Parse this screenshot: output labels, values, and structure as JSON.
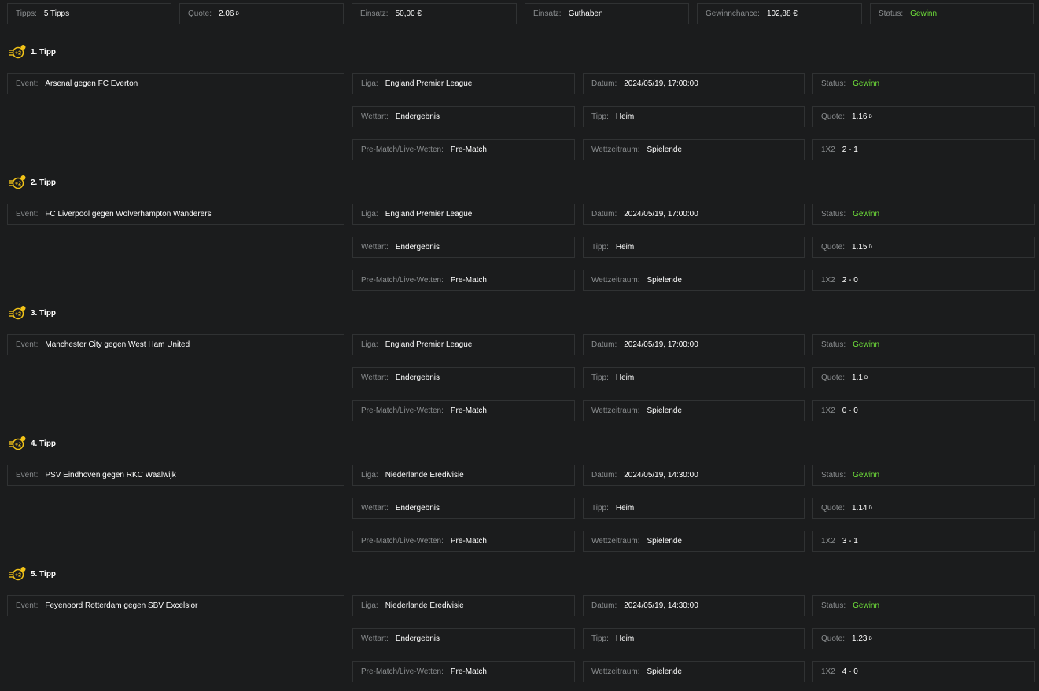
{
  "summary": [
    {
      "label": "Tipps:",
      "value": "5 Tipps",
      "sup": ""
    },
    {
      "label": "Quote:",
      "value": "2.06",
      "sup": "D"
    },
    {
      "label": "Einsatz:",
      "value": "50,00 €",
      "sup": ""
    },
    {
      "label": "Einsatz:",
      "value": "Guthaben",
      "sup": ""
    },
    {
      "label": "Gewinnchance:",
      "value": "102,88 €",
      "sup": ""
    },
    {
      "label": "Status:",
      "value": "Gewinn",
      "sup": "",
      "status": true
    }
  ],
  "labels": {
    "event": "Event:",
    "liga": "Liga:",
    "datum": "Datum:",
    "status": "Status:",
    "wettart": "Wettart:",
    "tipp": "Tipp:",
    "quote": "Quote:",
    "prematch": "Pre-Match/Live-Wetten:",
    "wettzeitraum": "Wettzeitraum:",
    "onex2": "1X2",
    "badge": "+2"
  },
  "tipps": [
    {
      "title": "1. Tipp",
      "event": "Arsenal gegen FC Everton",
      "liga": "England Premier League",
      "datum": "2024/05/19, 17:00:00",
      "status": "Gewinn",
      "wettart": "Endergebnis",
      "tipp": "Heim",
      "quote": "1.16",
      "quote_sup": "D",
      "prematch": "Pre-Match",
      "wettzeitraum": "Spielende",
      "result": "2 - 1"
    },
    {
      "title": "2. Tipp",
      "event": "FC Liverpool gegen Wolverhampton Wanderers",
      "liga": "England Premier League",
      "datum": "2024/05/19, 17:00:00",
      "status": "Gewinn",
      "wettart": "Endergebnis",
      "tipp": "Heim",
      "quote": "1.15",
      "quote_sup": "D",
      "prematch": "Pre-Match",
      "wettzeitraum": "Spielende",
      "result": "2 - 0"
    },
    {
      "title": "3. Tipp",
      "event": "Manchester City gegen West Ham United",
      "liga": "England Premier League",
      "datum": "2024/05/19, 17:00:00",
      "status": "Gewinn",
      "wettart": "Endergebnis",
      "tipp": "Heim",
      "quote": "1.1",
      "quote_sup": "D",
      "prematch": "Pre-Match",
      "wettzeitraum": "Spielende",
      "result": "0 - 0"
    },
    {
      "title": "4. Tipp",
      "event": "PSV Eindhoven gegen RKC Waalwijk",
      "liga": "Niederlande Eredivisie",
      "datum": "2024/05/19, 14:30:00",
      "status": "Gewinn",
      "wettart": "Endergebnis",
      "tipp": "Heim",
      "quote": "1.14",
      "quote_sup": "D",
      "prematch": "Pre-Match",
      "wettzeitraum": "Spielende",
      "result": "3 - 1"
    },
    {
      "title": "5. Tipp",
      "event": "Feyenoord Rotterdam gegen SBV Excelsior",
      "liga": "Niederlande Eredivisie",
      "datum": "2024/05/19, 14:30:00",
      "status": "Gewinn",
      "wettart": "Endergebnis",
      "tipp": "Heim",
      "quote": "1.23",
      "quote_sup": "D",
      "prematch": "Pre-Match",
      "wettzeitraum": "Spielende",
      "result": "4 - 0"
    }
  ],
  "colors": {
    "win": "#6fe03a",
    "accent": "#f2c318",
    "bg": "#1b1c1d",
    "border": "#303233",
    "label": "#8a8d8f"
  }
}
